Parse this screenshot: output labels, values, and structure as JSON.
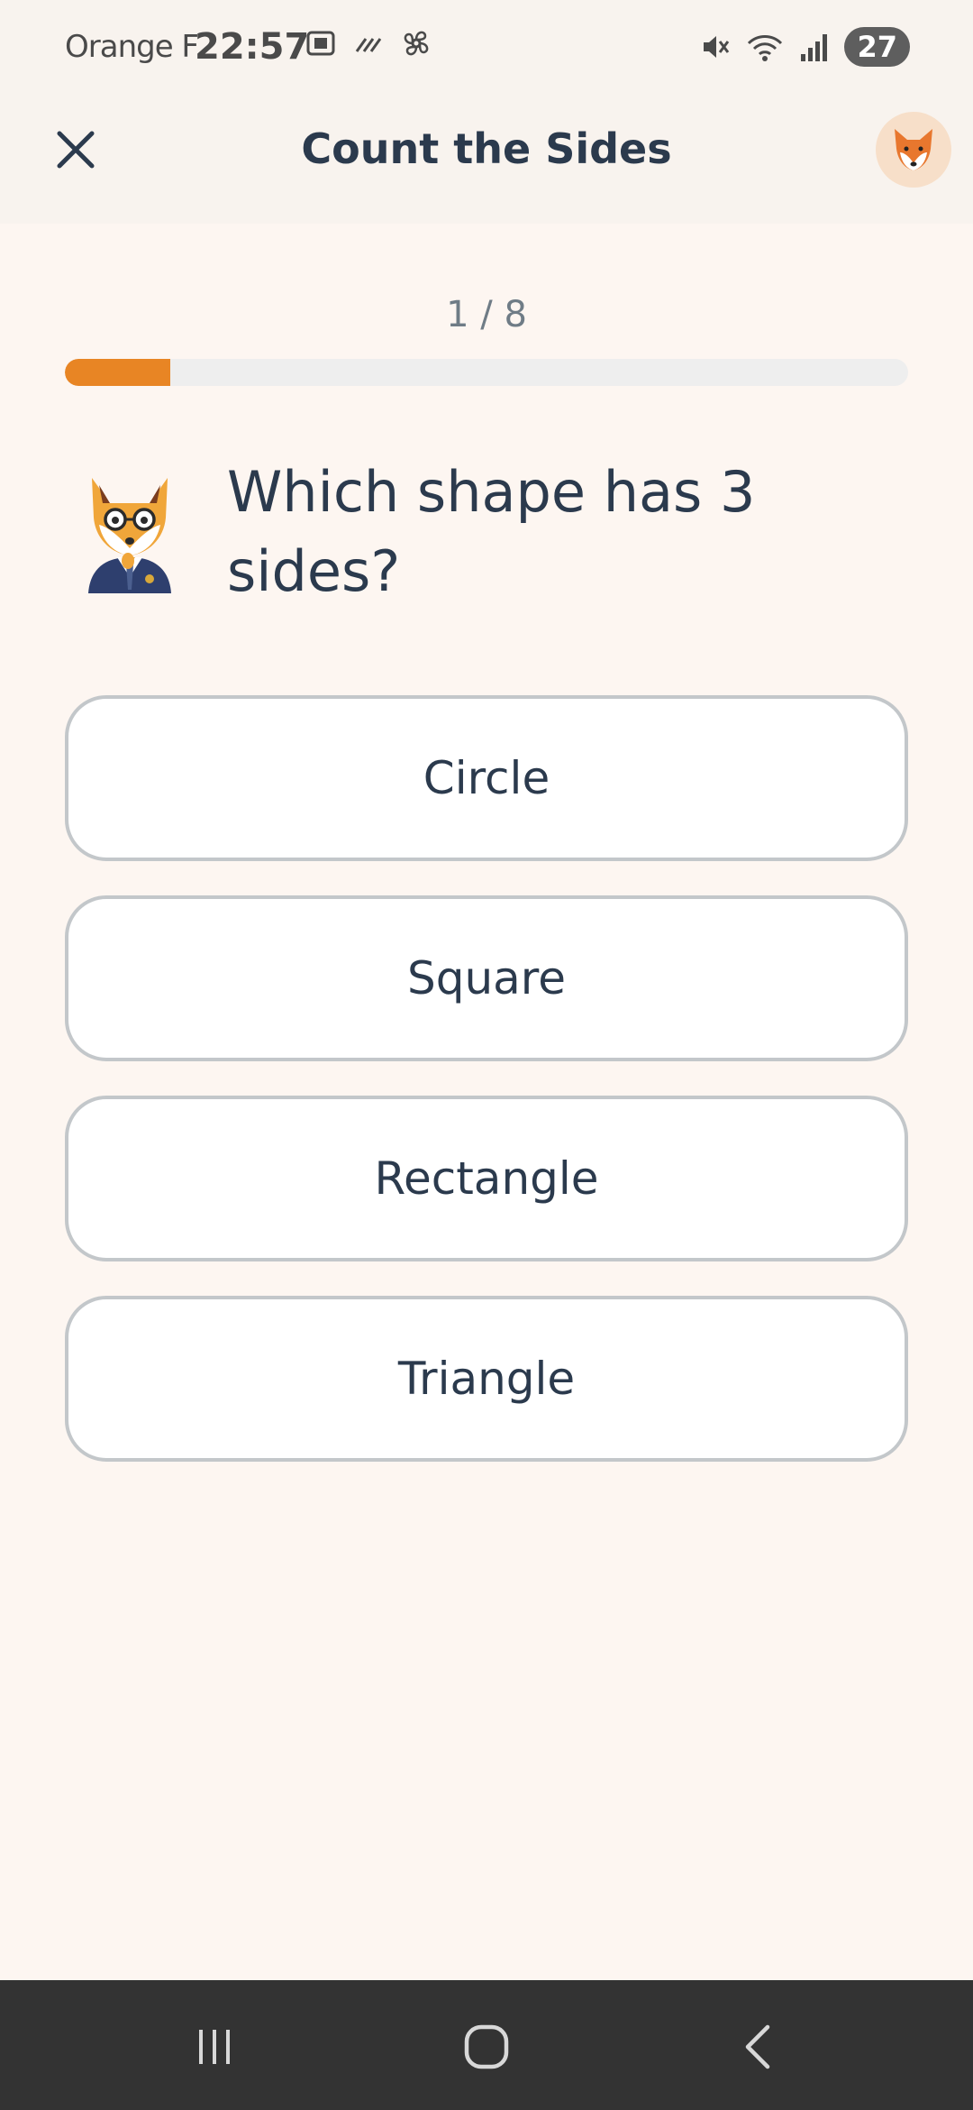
{
  "status_bar": {
    "carrier": "Orange F",
    "time": "22:57",
    "battery": "27",
    "icons_left": [
      "screenshot-icon",
      "signal-bars-slash-icon",
      "pinwheel-icon"
    ],
    "icons_right": [
      "mute-icon",
      "wifi-icon",
      "cell-signal-icon"
    ]
  },
  "header": {
    "title": "Count the Sides",
    "close_icon": "close-icon",
    "avatar_icon": "fox-face-icon"
  },
  "progress": {
    "label": "1 / 8",
    "fraction": 0.125,
    "color": "#e88524"
  },
  "question": {
    "text": "Which shape has 3 sides?",
    "mascot_icon": "fox-mascot-icon"
  },
  "options": [
    {
      "label": "Circle"
    },
    {
      "label": "Square"
    },
    {
      "label": "Rectangle"
    },
    {
      "label": "Triangle"
    }
  ],
  "nav_bar": {
    "buttons": [
      "recent-apps-icon",
      "home-icon",
      "back-icon"
    ]
  }
}
